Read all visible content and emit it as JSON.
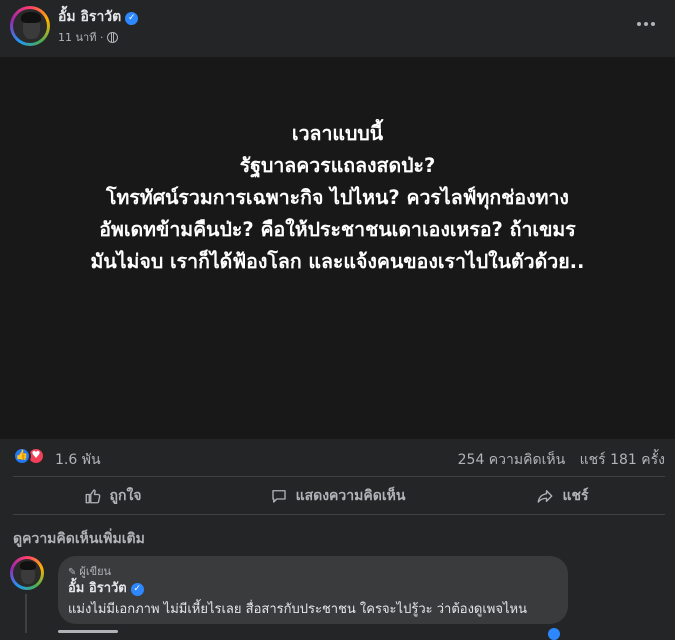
{
  "post": {
    "author": "อั้ม อิราวัต",
    "time": "11 นาที ·",
    "text_lines": [
      "เวลาแบบนี้",
      "รัฐบาลควรแถลงสดป่ะ?",
      "โทรทัศน์รวมการเฉพาะกิจ ไปไหน? ควรไลฟ์ทุกช่องทาง",
      "อัพเดทข้ามคืนป่ะ? คือให้ประชาชนเดาเองเหรอ? ถ้าเขมร",
      "มันไม่จบ เราก็ได้ฟ้องโลก และแจ้งคนของเราไปในตัวด้วย.."
    ]
  },
  "stats": {
    "reactions": "1.6 พัน",
    "comments": "254 ความคิดเห็น",
    "shares": "แชร์ 181 ครั้ง"
  },
  "actions": {
    "like": "ถูกใจ",
    "comment": "แสดงความคิดเห็น",
    "share": "แชร์"
  },
  "comments_section": {
    "more_comments": "ดูความคิดเห็นเพิ่มเติม",
    "items": [
      {
        "badge": "ผู้เขียน",
        "author": "อั้ม อิราวัต",
        "text": "แม่งไม่มีเอกภาพ ไม่มีเหี้ยไรเลย สื่อสารกับประชาชน ใครจะไปรู้วะ ว่าต้องดูเพจไหน"
      }
    ]
  },
  "colors": {
    "background": "#242526",
    "image_background": "#181818",
    "verified": "#2d88ff",
    "like": "#2078f4",
    "love": "#f33e58"
  }
}
